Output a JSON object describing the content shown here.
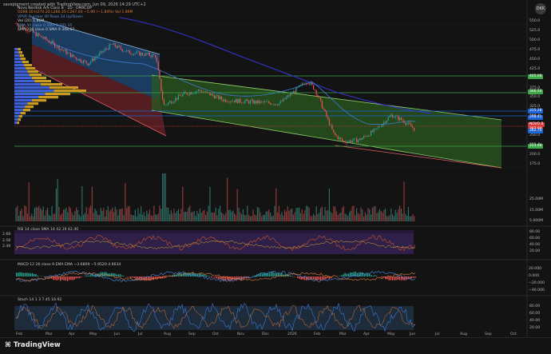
{
  "header": {
    "created_by": "savepigment created with TradingView.com, Jun 09, 2026 14:29 UTC+2",
    "ticker_badge": "DKK"
  },
  "legend": {
    "main": "Novo Nordisk A/S Class B · 1D · OMXCOP",
    "ohlc": "O268.10  H270.20  L266.35  C267.00  −5.90 (−1.84%)  Vol 1.86M",
    "vpvr": "VPVR Number Of Rows 24 Up/Down",
    "vol": "Vol (20)  1.86M",
    "sma50": "SMA 50 close 0 SMA 9  285.35",
    "sma200": "SMA 200 close 0 SMA 9  348.67",
    "rsi": "RSI 14 close SMA 14  42.19  42.40",
    "macd": "MACD 12 26 close 9 EMA EMA  −3.6809  −5.9520  4.6634",
    "stoch": "Stoch 14 1 3  7.45  16.92"
  },
  "price_axis": {
    "ticks": [
      "550.0",
      "525.0",
      "500.0",
      "475.0",
      "450.0",
      "425.0",
      "400.0",
      "375.0",
      "350.0",
      "325.0",
      "300.0",
      "275.0",
      "250.0",
      "225.0",
      "200.0",
      "175.0"
    ],
    "badges": [
      {
        "label": "405.08",
        "color": "#3fa64a",
        "price": 405
      },
      {
        "label": "366.50",
        "color": "#3fa64a",
        "price": 366.5
      },
      {
        "label": "315.28",
        "color": "#1e63d6",
        "price": 315.3
      },
      {
        "label": "298.41",
        "color": "#1e63d6",
        "price": 298.4
      },
      {
        "label": "NOVO B",
        "color": "#d43b3b",
        "price": 280
      },
      {
        "label": "267.00",
        "color": "#d43b3b",
        "price": 267
      },
      {
        "label": "262.70",
        "color": "#1e63d6",
        "price": 262.7
      },
      {
        "label": "223.48",
        "color": "#3fa64a",
        "price": 223.5
      }
    ]
  },
  "volume_axis": {
    "ticks": [
      "25.00M",
      "15.00M",
      "5.000M"
    ]
  },
  "rsi_axis": {
    "ticks": [
      "80.00",
      "60.00",
      "40.00",
      "20.00"
    ],
    "left_ticks": [
      "2.68",
      "2.58",
      "2.48"
    ]
  },
  "macd_axis": {
    "ticks": [
      "20.000",
      "0.000",
      "−20.000",
      "−40.000"
    ]
  },
  "stoch_axis": {
    "ticks": [
      "80.00",
      "60.00",
      "40.00",
      "20.00"
    ]
  },
  "time_axis": {
    "ticks": [
      "Feb",
      "Mar",
      "Apr",
      "May",
      "Jun",
      "Jul",
      "Aug",
      "Sep",
      "Oct",
      "Nov",
      "Dec",
      "2026",
      "Feb",
      "Mar",
      "Apr",
      "May",
      "Jun",
      "Jul",
      "Aug",
      "Sep",
      "Oct"
    ]
  },
  "footer": {
    "logo": "TradingView"
  },
  "colors": {
    "bg": "#131313",
    "up": "#26a69a",
    "down": "#ef5350",
    "sma50": "#3e7bd6",
    "sma200": "#3333cc",
    "channel_green": "#2e5a22",
    "channel_red": "#5a1f24",
    "channel_blue": "#1f4a7a",
    "vpvr_blue": "#3d5fd8",
    "vpvr_yellow": "#c89a24"
  }
}
